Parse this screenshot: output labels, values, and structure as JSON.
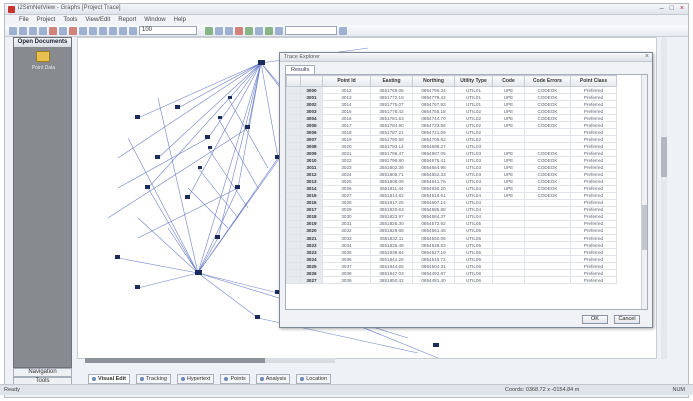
{
  "window": {
    "title": "i2SimNetView - Graphs [Project Trace]",
    "min": "–",
    "max": "□",
    "close": "×"
  },
  "menu": [
    "File",
    "Project",
    "Tools",
    "View/Edit",
    "Report",
    "Window",
    "Help"
  ],
  "toolbar": {
    "zoom_value": "100"
  },
  "sidebar": {
    "header": "Open Documents",
    "doc_label": "Point Data",
    "tabs": [
      "Navigation",
      "Tools"
    ]
  },
  "canvas": {
    "scroll_label": "|||"
  },
  "bottom_tabs": [
    "Visual Edit",
    "Tracking",
    "Hypertext",
    "Points",
    "Analysis",
    "Location"
  ],
  "statusbar": {
    "left": "Ready",
    "coords": "Coords: 0368.72 x -0154.84 m",
    "right": "NUM"
  },
  "dialog": {
    "title": "Trace Explorer",
    "tab": "Results",
    "ok": "OK",
    "cancel": "Cancel",
    "columns": [
      "Point Id",
      "Easting",
      "Northing",
      "Utility Type",
      "Code",
      "Code Errors",
      "Point Class"
    ],
    "rows": [
      [
        "3000",
        "3012",
        "3551769.05",
        "0854790.34",
        "UTIL01",
        "UPE",
        "CODEOK",
        "Preferred"
      ],
      [
        "3001",
        "3013",
        "3551772.19",
        "0854779.42",
        "UTIL01",
        "UPE",
        "CODEOK",
        "Preferred"
      ],
      [
        "3002",
        "3014",
        "3551775.07",
        "0854767.93",
        "UTIL01",
        "UPE",
        "CODEOK",
        "Preferred"
      ],
      [
        "3003",
        "3015",
        "3551778.42",
        "0854755.18",
        "UTIL02",
        "UPE",
        "CODEOK",
        "Preferred"
      ],
      [
        "3004",
        "3016",
        "3551781.63",
        "0854744.70",
        "UTIL02",
        "UPE",
        "CODEOK",
        "Preferred"
      ],
      [
        "3005",
        "3017",
        "3551784.90",
        "0854733.56",
        "UTIL02",
        "UPE",
        "CODEOK",
        "Preferred"
      ],
      [
        "3006",
        "3018",
        "3551787.21",
        "0854721.09",
        "UTIL02",
        "",
        "",
        "Preferred"
      ],
      [
        "3007",
        "3019",
        "3551790.58",
        "0854709.62",
        "UTIL02",
        "",
        "",
        "Preferred"
      ],
      [
        "3008",
        "3020",
        "3551793.14",
        "0854698.27",
        "UTIL03",
        "",
        "",
        "Preferred"
      ],
      [
        "3009",
        "3021",
        "3551796.47",
        "0854687.05",
        "UTIL03",
        "UPE",
        "CODEOK",
        "Preferred"
      ],
      [
        "3010",
        "3022",
        "3551799.80",
        "0854675.41",
        "UTIL03",
        "UPE",
        "CODEOK",
        "Preferred"
      ],
      [
        "3011",
        "3023",
        "3551802.36",
        "0854664.98",
        "UTIL03",
        "UPE",
        "CODEOK",
        "Preferred"
      ],
      [
        "3012",
        "3024",
        "3551805.71",
        "0854652.33",
        "UTIL03",
        "UPE",
        "CODEOK",
        "Preferred"
      ],
      [
        "3013",
        "3025",
        "3551808.09",
        "0854641.76",
        "UTIL03",
        "UPE",
        "CODEOK",
        "Preferred"
      ],
      [
        "3014",
        "3026",
        "3551811.44",
        "0854630.20",
        "UTIL04",
        "UPE",
        "CODEOK",
        "Preferred"
      ],
      [
        "3015",
        "3027",
        "3551814.82",
        "0854618.61",
        "UTIL04",
        "UPE",
        "CODEOK",
        "Preferred"
      ],
      [
        "3016",
        "3028",
        "3551817.25",
        "0854607.14",
        "UTIL04",
        "",
        "",
        "Preferred"
      ],
      [
        "3017",
        "3029",
        "3551820.63",
        "0854595.88",
        "UTIL04",
        "",
        "",
        "Preferred"
      ],
      [
        "3018",
        "3030",
        "3551823.97",
        "0854584.37",
        "UTIL04",
        "",
        "",
        "Preferred"
      ],
      [
        "3019",
        "3031",
        "3551826.30",
        "0854572.92",
        "UTIL05",
        "",
        "",
        "Preferred"
      ],
      [
        "3020",
        "3032",
        "3551829.68",
        "0854561.45",
        "UTIL05",
        "",
        "",
        "Preferred"
      ],
      [
        "3021",
        "3033",
        "3551832.11",
        "0854550.06",
        "UTIL05",
        "",
        "",
        "Preferred"
      ],
      [
        "3022",
        "3034",
        "3551835.49",
        "0854538.53",
        "UTIL05",
        "",
        "",
        "Preferred"
      ],
      [
        "3023",
        "3035",
        "3551838.84",
        "0854527.19",
        "UTIL05",
        "",
        "",
        "Preferred"
      ],
      [
        "3024",
        "3036",
        "3551841.26",
        "0854515.72",
        "UTIL06",
        "",
        "",
        "Preferred"
      ],
      [
        "3025",
        "3037",
        "3551844.65",
        "0854504.31",
        "UTIL06",
        "",
        "",
        "Preferred"
      ],
      [
        "3026",
        "3038",
        "3551847.03",
        "0854492.87",
        "UTIL06",
        "",
        "",
        "Preferred"
      ],
      [
        "3027",
        "3039",
        "3551850.42",
        "0854481.40",
        "UTIL06",
        "",
        "",
        "Preferred"
      ]
    ]
  }
}
